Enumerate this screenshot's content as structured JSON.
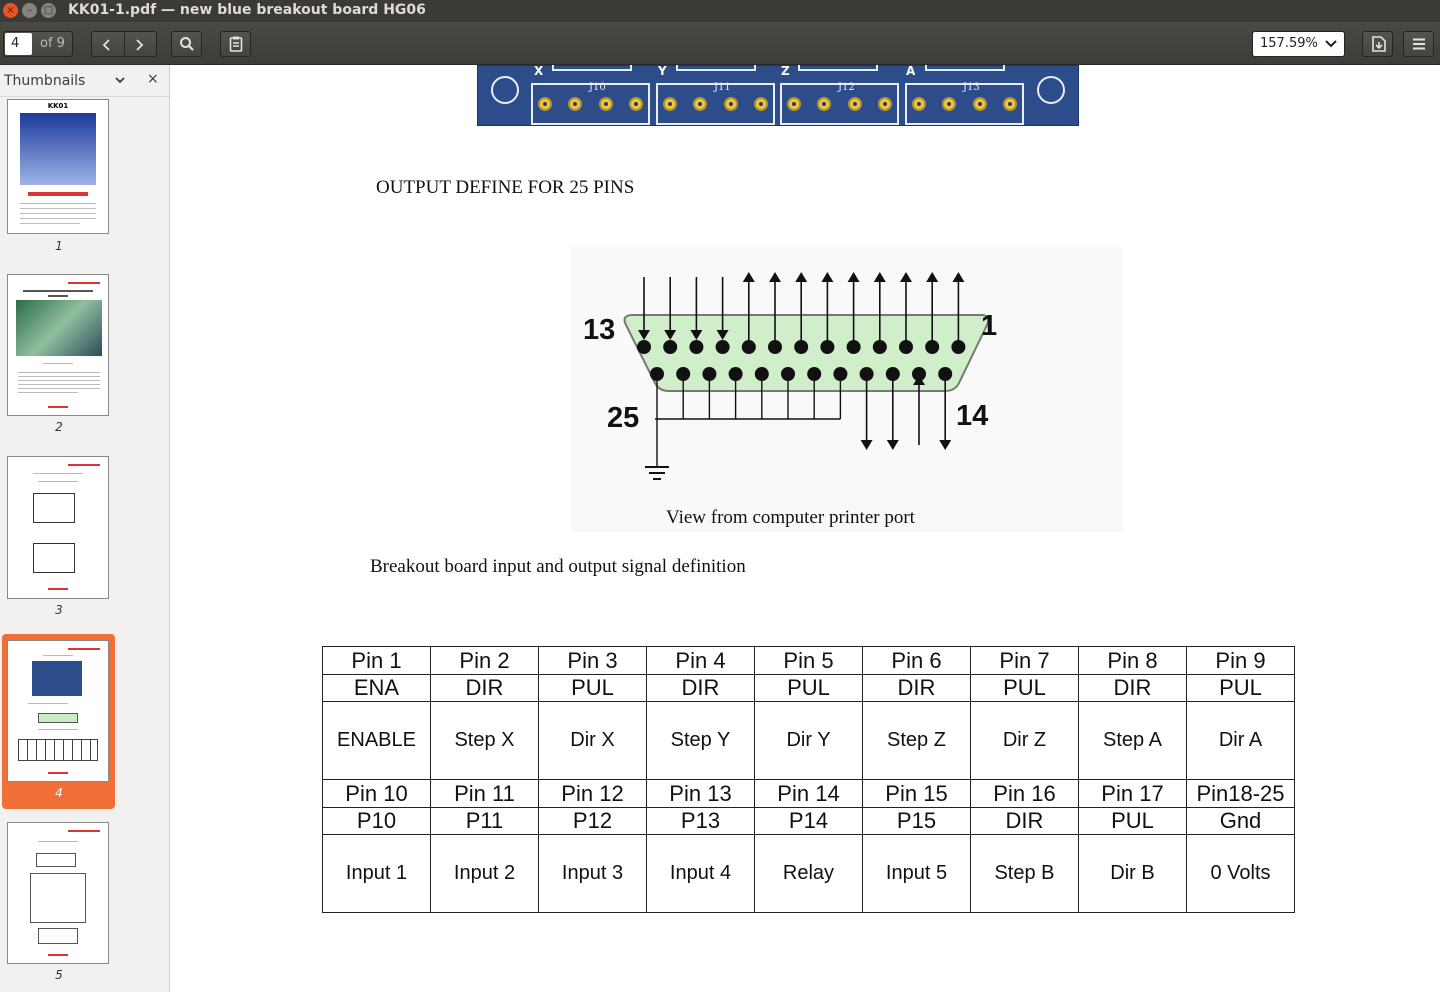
{
  "window": {
    "title": "KK01-1.pdf — new blue breakout board HG06",
    "close_glyph": "×",
    "min_glyph": "–",
    "max_glyph": "□"
  },
  "toolbar": {
    "page_current": "4",
    "page_total": "of 9",
    "zoom": "157.59%",
    "icons": [
      "chevron-left-icon",
      "chevron-right-icon",
      "search-icon",
      "annotations-icon",
      "chevron-down-icon",
      "save-icon",
      "menu-icon"
    ]
  },
  "sidebar": {
    "title": "Thumbnails",
    "close_glyph": "×",
    "thumbnails": [
      {
        "page": "1",
        "selected": false
      },
      {
        "page": "2",
        "selected": false
      },
      {
        "page": "3",
        "selected": false
      },
      {
        "page": "4",
        "selected": true
      },
      {
        "page": "5",
        "selected": false
      }
    ],
    "selected_color": "#ef6f36"
  },
  "document": {
    "pcb_labels": [
      "J10",
      "J11",
      "J12",
      "J13"
    ],
    "pcb_top_marks": [
      "X",
      "Y",
      "Z",
      "A"
    ],
    "output_heading": "OUTPUT DEFINE FOR 25 PINS",
    "connector": {
      "label_13": "13",
      "label_1": "1",
      "label_25": "25",
      "label_14": "14"
    },
    "figure_caption": "View from computer printer port",
    "table_heading": "Breakout board input and output signal definition",
    "table": {
      "row1_pins": [
        "Pin 1",
        "Pin 2",
        "Pin 3",
        "Pin 4",
        "Pin 5",
        "Pin 6",
        "Pin 7",
        "Pin 8",
        "Pin 9"
      ],
      "row1_signals": [
        "ENA",
        "DIR",
        "PUL",
        "DIR",
        "PUL",
        "DIR",
        "PUL",
        "DIR",
        "PUL"
      ],
      "row1_desc": [
        "ENABLE",
        "Step X",
        "Dir X",
        "Step Y",
        "Dir Y",
        "Step Z",
        "Dir Z",
        "Step A",
        "Dir A"
      ],
      "row2_pins": [
        "Pin 10",
        "Pin 11",
        "Pin 12",
        "Pin 13",
        "Pin 14",
        "Pin 15",
        "Pin 16",
        "Pin 17",
        "Pin18-25"
      ],
      "row2_signals": [
        "P10",
        "P11",
        "P12",
        "P13",
        "P14",
        "P15",
        "DIR",
        "PUL",
        "Gnd"
      ],
      "row2_desc": [
        "Input 1",
        "Input 2",
        "Input 3",
        "Input 4",
        "Relay",
        "Input 5",
        "Step B",
        "Dir B",
        "0 Volts"
      ]
    }
  }
}
